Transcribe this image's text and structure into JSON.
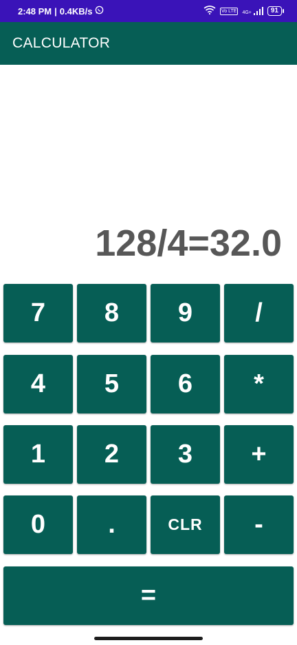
{
  "status_bar": {
    "time": "2:48 PM",
    "speed": "0.4KB/s",
    "network": "4G+",
    "volte": "Vo LTE",
    "battery": "91"
  },
  "app_bar": {
    "title": "CALCULATOR"
  },
  "display": {
    "expression": "128/4=32.0"
  },
  "keypad": {
    "rows": [
      [
        "7",
        "8",
        "9",
        "/"
      ],
      [
        "4",
        "5",
        "6",
        "*"
      ],
      [
        "1",
        "2",
        "3",
        "+"
      ],
      [
        "0",
        ".",
        "CLR",
        "-"
      ]
    ],
    "equals": "="
  },
  "colors": {
    "primary": "#065e55",
    "status_bar": "#3a13b8",
    "display_text": "#575757"
  }
}
